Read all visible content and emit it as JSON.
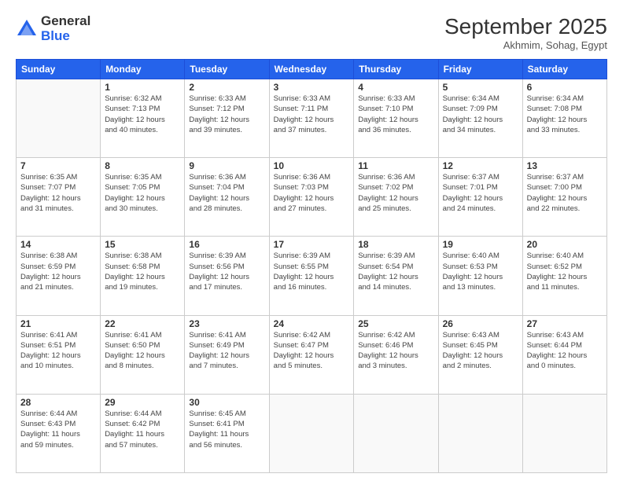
{
  "header": {
    "logo_line1": "General",
    "logo_line2": "Blue",
    "month": "September 2025",
    "location": "Akhmim, Sohag, Egypt"
  },
  "days_of_week": [
    "Sunday",
    "Monday",
    "Tuesday",
    "Wednesday",
    "Thursday",
    "Friday",
    "Saturday"
  ],
  "weeks": [
    [
      {
        "day": "",
        "info": ""
      },
      {
        "day": "1",
        "info": "Sunrise: 6:32 AM\nSunset: 7:13 PM\nDaylight: 12 hours\nand 40 minutes."
      },
      {
        "day": "2",
        "info": "Sunrise: 6:33 AM\nSunset: 7:12 PM\nDaylight: 12 hours\nand 39 minutes."
      },
      {
        "day": "3",
        "info": "Sunrise: 6:33 AM\nSunset: 7:11 PM\nDaylight: 12 hours\nand 37 minutes."
      },
      {
        "day": "4",
        "info": "Sunrise: 6:33 AM\nSunset: 7:10 PM\nDaylight: 12 hours\nand 36 minutes."
      },
      {
        "day": "5",
        "info": "Sunrise: 6:34 AM\nSunset: 7:09 PM\nDaylight: 12 hours\nand 34 minutes."
      },
      {
        "day": "6",
        "info": "Sunrise: 6:34 AM\nSunset: 7:08 PM\nDaylight: 12 hours\nand 33 minutes."
      }
    ],
    [
      {
        "day": "7",
        "info": "Sunrise: 6:35 AM\nSunset: 7:07 PM\nDaylight: 12 hours\nand 31 minutes."
      },
      {
        "day": "8",
        "info": "Sunrise: 6:35 AM\nSunset: 7:05 PM\nDaylight: 12 hours\nand 30 minutes."
      },
      {
        "day": "9",
        "info": "Sunrise: 6:36 AM\nSunset: 7:04 PM\nDaylight: 12 hours\nand 28 minutes."
      },
      {
        "day": "10",
        "info": "Sunrise: 6:36 AM\nSunset: 7:03 PM\nDaylight: 12 hours\nand 27 minutes."
      },
      {
        "day": "11",
        "info": "Sunrise: 6:36 AM\nSunset: 7:02 PM\nDaylight: 12 hours\nand 25 minutes."
      },
      {
        "day": "12",
        "info": "Sunrise: 6:37 AM\nSunset: 7:01 PM\nDaylight: 12 hours\nand 24 minutes."
      },
      {
        "day": "13",
        "info": "Sunrise: 6:37 AM\nSunset: 7:00 PM\nDaylight: 12 hours\nand 22 minutes."
      }
    ],
    [
      {
        "day": "14",
        "info": "Sunrise: 6:38 AM\nSunset: 6:59 PM\nDaylight: 12 hours\nand 21 minutes."
      },
      {
        "day": "15",
        "info": "Sunrise: 6:38 AM\nSunset: 6:58 PM\nDaylight: 12 hours\nand 19 minutes."
      },
      {
        "day": "16",
        "info": "Sunrise: 6:39 AM\nSunset: 6:56 PM\nDaylight: 12 hours\nand 17 minutes."
      },
      {
        "day": "17",
        "info": "Sunrise: 6:39 AM\nSunset: 6:55 PM\nDaylight: 12 hours\nand 16 minutes."
      },
      {
        "day": "18",
        "info": "Sunrise: 6:39 AM\nSunset: 6:54 PM\nDaylight: 12 hours\nand 14 minutes."
      },
      {
        "day": "19",
        "info": "Sunrise: 6:40 AM\nSunset: 6:53 PM\nDaylight: 12 hours\nand 13 minutes."
      },
      {
        "day": "20",
        "info": "Sunrise: 6:40 AM\nSunset: 6:52 PM\nDaylight: 12 hours\nand 11 minutes."
      }
    ],
    [
      {
        "day": "21",
        "info": "Sunrise: 6:41 AM\nSunset: 6:51 PM\nDaylight: 12 hours\nand 10 minutes."
      },
      {
        "day": "22",
        "info": "Sunrise: 6:41 AM\nSunset: 6:50 PM\nDaylight: 12 hours\nand 8 minutes."
      },
      {
        "day": "23",
        "info": "Sunrise: 6:41 AM\nSunset: 6:49 PM\nDaylight: 12 hours\nand 7 minutes."
      },
      {
        "day": "24",
        "info": "Sunrise: 6:42 AM\nSunset: 6:47 PM\nDaylight: 12 hours\nand 5 minutes."
      },
      {
        "day": "25",
        "info": "Sunrise: 6:42 AM\nSunset: 6:46 PM\nDaylight: 12 hours\nand 3 minutes."
      },
      {
        "day": "26",
        "info": "Sunrise: 6:43 AM\nSunset: 6:45 PM\nDaylight: 12 hours\nand 2 minutes."
      },
      {
        "day": "27",
        "info": "Sunrise: 6:43 AM\nSunset: 6:44 PM\nDaylight: 12 hours\nand 0 minutes."
      }
    ],
    [
      {
        "day": "28",
        "info": "Sunrise: 6:44 AM\nSunset: 6:43 PM\nDaylight: 11 hours\nand 59 minutes."
      },
      {
        "day": "29",
        "info": "Sunrise: 6:44 AM\nSunset: 6:42 PM\nDaylight: 11 hours\nand 57 minutes."
      },
      {
        "day": "30",
        "info": "Sunrise: 6:45 AM\nSunset: 6:41 PM\nDaylight: 11 hours\nand 56 minutes."
      },
      {
        "day": "",
        "info": ""
      },
      {
        "day": "",
        "info": ""
      },
      {
        "day": "",
        "info": ""
      },
      {
        "day": "",
        "info": ""
      }
    ]
  ]
}
